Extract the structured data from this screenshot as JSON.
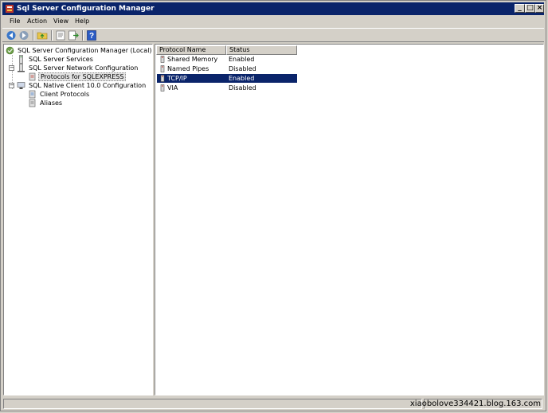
{
  "window": {
    "title": "Sql Server Configuration Manager"
  },
  "menu": [
    {
      "label": "File"
    },
    {
      "label": "Action"
    },
    {
      "label": "View"
    },
    {
      "label": "Help"
    }
  ],
  "toolbar": [
    "back-icon",
    "forward-icon",
    "up-folder-icon",
    "properties-icon",
    "export-icon",
    "help-icon"
  ],
  "tree": {
    "root": "SQL Server Configuration Manager (Local)",
    "services": "SQL Server Services",
    "network_config": "SQL Server Network Configuration",
    "protocols": "Protocols for SQLEXPRESS",
    "native_client": "SQL Native Client 10.0 Configuration",
    "client_protocols": "Client Protocols",
    "aliases": "Aliases"
  },
  "list": {
    "columns": [
      "Protocol Name",
      "Status"
    ],
    "rows": [
      {
        "name": "Shared Memory",
        "status": "Enabled"
      },
      {
        "name": "Named Pipes",
        "status": "Disabled"
      },
      {
        "name": "TCP/IP",
        "status": "Enabled"
      },
      {
        "name": "VIA",
        "status": "Disabled"
      }
    ],
    "selected": "TCP/IP"
  },
  "status_bar": {
    "watermark": "xiaobolove334421.blog.163.com"
  },
  "colors": {
    "titlebar": "#0a246a",
    "selection": "#0a246a",
    "chrome": "#d4d0c8"
  }
}
